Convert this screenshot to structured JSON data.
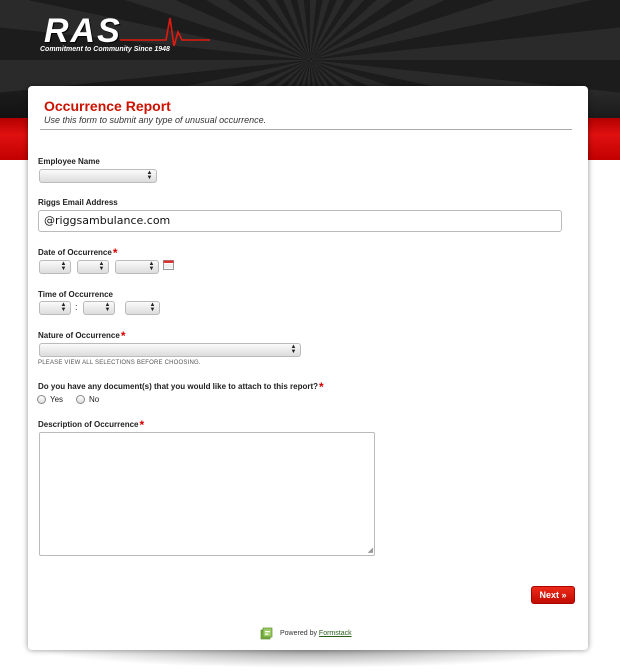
{
  "header": {
    "logo_text": "RAS",
    "tagline": "Commitment to Community Since 1948"
  },
  "form": {
    "title": "Occurrence Report",
    "subtitle": "Use this form to submit any type of unusual occurrence.",
    "employee_name": {
      "label": "Employee Name",
      "value": ""
    },
    "email": {
      "label": "Riggs Email Address",
      "value": "@riggsambulance.com"
    },
    "date": {
      "label": "Date of Occurrence",
      "required_mark": "*",
      "month": "",
      "day": "",
      "year": ""
    },
    "time": {
      "label": "Time of Occurrence",
      "separator": ":",
      "hour": "",
      "minute": "",
      "ampm": ""
    },
    "nature": {
      "label": "Nature of Occurrence",
      "required_mark": "*",
      "value": "",
      "hint": "PLEASE VIEW ALL SELECTIONS BEFORE CHOOSING."
    },
    "documents": {
      "label": "Do you have any document(s) that you would like to attach to this report?",
      "required_mark": "*",
      "options": [
        "Yes",
        "No"
      ]
    },
    "description": {
      "label": "Description of Occurrence",
      "required_mark": "*",
      "value": ""
    },
    "next_label": "Next »"
  },
  "footer": {
    "powered_text": "Powered by",
    "powered_link": "Formstack"
  },
  "colors": {
    "accent_red": "#cc1100",
    "required_red": "#d40000",
    "button_red": "#d81a0a"
  },
  "icons": {
    "calendar": "calendar-icon",
    "formstack": "formstack-logo-icon"
  }
}
